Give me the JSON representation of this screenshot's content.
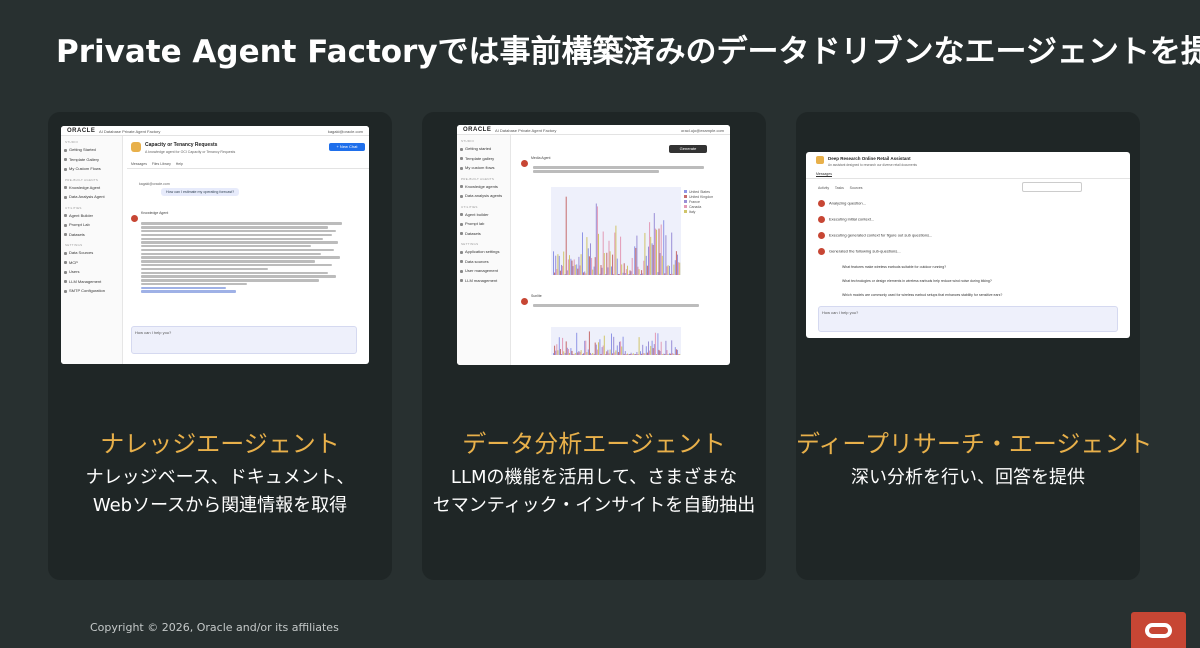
{
  "slide": {
    "title": "Private Agent Factoryでは事前構築済みのデータドリブンなエージェントを提供",
    "copyright": "Copyright © 2026, Oracle and/or its affiliates"
  },
  "cards": [
    {
      "title": "ナレッジエージェント",
      "desc_line1": "ナレッジベース、ドキュメント、",
      "desc_line2": "Webソースから関連情報を取得",
      "screenshot": {
        "logo": "ORACLE",
        "app_title": "AI Database Private Agent Factory",
        "user": "kagaki@oracle.com",
        "sidebar": [
          {
            "section": "STUDIO",
            "items": [
              "Getting Started",
              "Template Gallery",
              "My Custom Flows"
            ]
          },
          {
            "section": "PRE-BUILT AGENTS",
            "items": [
              "Knowledge Agent",
              "Data Analysis Agent"
            ]
          },
          {
            "section": "UTILITIES",
            "items": [
              "Agent Builder",
              "Prompt Lab",
              "Datasets"
            ]
          },
          {
            "section": "SETTINGS",
            "items": [
              "Data Sources",
              "MCP",
              "Users",
              "LLM Management",
              "SMTP Configuration"
            ]
          }
        ],
        "page_title": "Capacity or Tenancy Requests",
        "page_subtitle": "A knowledge agent for OCI Capacity or Tenancy Requests",
        "new_chat": "+ New Chat",
        "tabs": [
          "Messages",
          "Files Library",
          "Help"
        ],
        "user_q": "How can I estimate my operating forecast?",
        "agent_name": "Knowledge Agent",
        "input_placeholder": "How can I help you?"
      }
    },
    {
      "title": "データ分析エージェント",
      "desc_line1": "LLMの機能を活用して、さまざまな",
      "desc_line2": "セマンティック・インサイトを自動抽出",
      "screenshot": {
        "logo": "ORACLE",
        "app_title": "AI Database Private Agent Factory",
        "user": "oracl.ujo@example.com",
        "sidebar": [
          {
            "section": "STUDIO",
            "items": [
              "Getting started",
              "Template gallery",
              "My custom flows"
            ]
          },
          {
            "section": "PRE-BUILT AGENTS",
            "items": [
              "Knowledge agents",
              "Data analysis agents"
            ]
          },
          {
            "section": "UTILITIES",
            "items": [
              "Agent builder",
              "Prompt lab",
              "Datasets"
            ]
          },
          {
            "section": "SETTINGS",
            "items": [
              "Application settings",
              "Data sources",
              "User management",
              "LLM management"
            ]
          }
        ],
        "agent1": "Media Agent",
        "agent2": "Sunlite",
        "export": "Generate explanation",
        "legend": [
          "United States",
          "United Kingdom",
          "France",
          "Canada",
          "Italy"
        ]
      }
    },
    {
      "title": "ディープリサーチ・エージェント",
      "desc_line1": "深い分析を行い、回答を提供",
      "desc_line2": "",
      "screenshot": {
        "app_title": "Deep Research Online Retail Assistant",
        "app_sub": "An assistant designed to research our diverse retail documents",
        "tab": "Messages",
        "sub_tabs": [
          "Activity",
          "Tasks",
          "Sources"
        ],
        "steps": [
          "Analyzing question...",
          "Executing initial context...",
          "Executing generated context for figure out sub questions...",
          "Generated the following sub-questions..."
        ],
        "questions": [
          "What features make wireless earbuds suitable for outdoor running?",
          "What technologies or design elements in wireless earbuds help reduce wind noise during biking?",
          "Which models are commonly used for wireless earbud setups that enhances stability for sensitive ears?"
        ],
        "input": "How can I help you?"
      }
    }
  ],
  "colors": {
    "background": "#283030",
    "card": "#1f2626",
    "accent_title": "#e8b04a",
    "oracle_red": "#c74634"
  },
  "chart_colors": [
    "#8f95e6",
    "#c56b6b",
    "#9a8fd6",
    "#e39ab6",
    "#d0c56a"
  ]
}
